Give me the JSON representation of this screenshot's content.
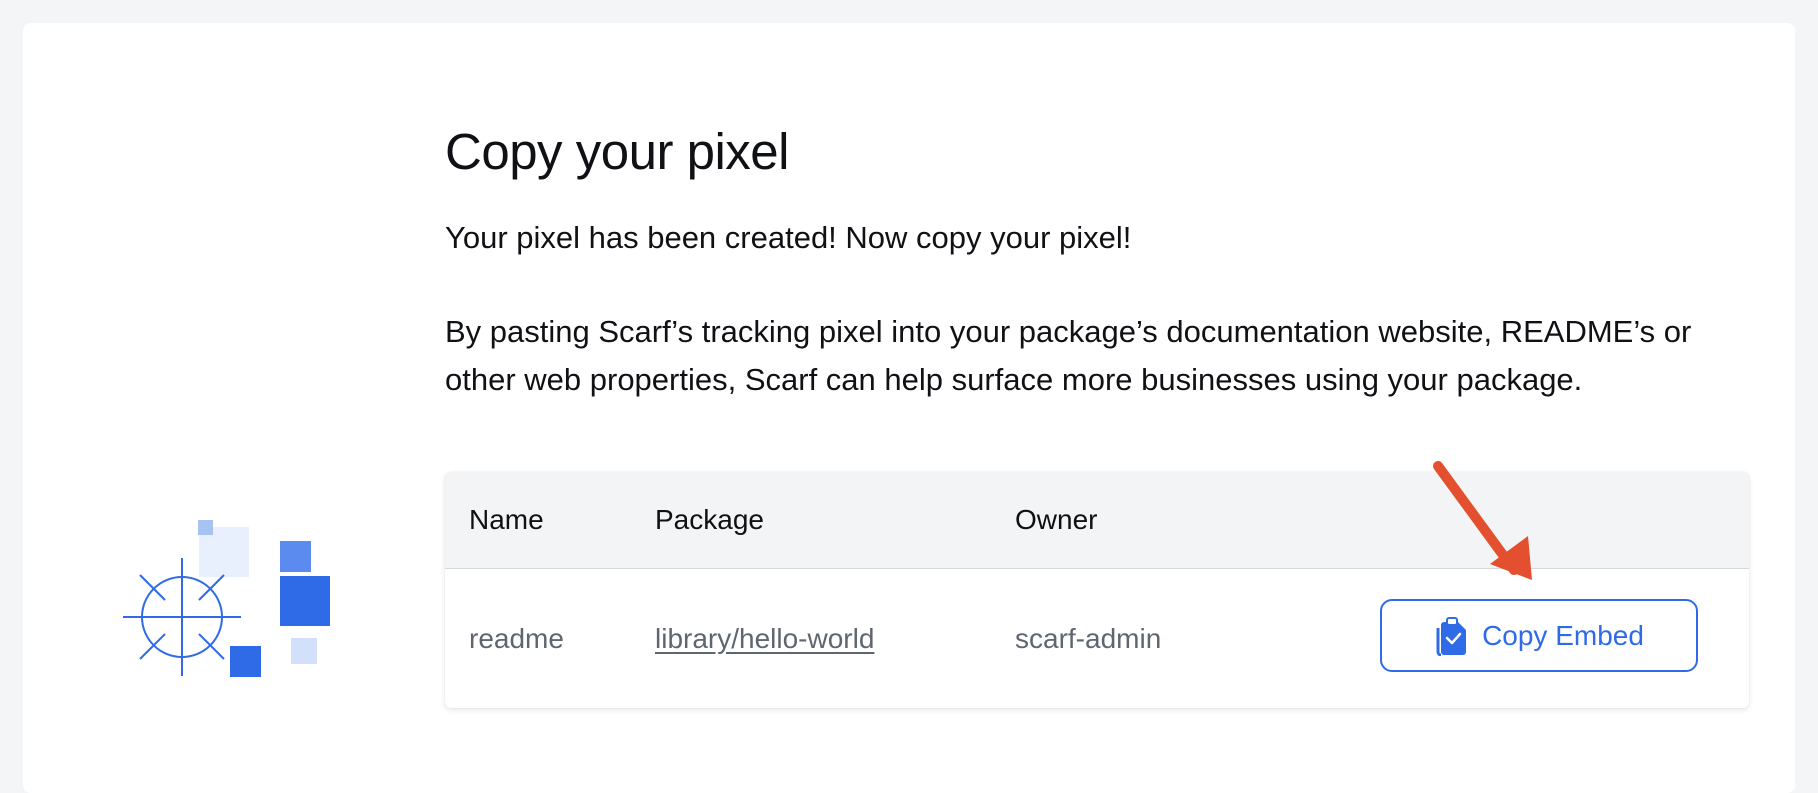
{
  "page": {
    "title": "Copy your pixel",
    "intro": "Your pixel has been created! Now copy your pixel!",
    "description": "By pasting Scarf’s tracking pixel into your package’s documentation website, README’s or other web properties, Scarf can help surface more businesses using your package."
  },
  "table": {
    "headers": {
      "name": "Name",
      "package": "Package",
      "owner": "Owner"
    },
    "rows": [
      {
        "name": "readme",
        "package": "library/hello-world",
        "owner": "scarf-admin",
        "action": "Copy Embed"
      }
    ]
  },
  "icons": {
    "copy": "clipboard-copy-icon",
    "illustration": "pixel-sun-illustration",
    "annotation": "red-arrow-annotation"
  },
  "colors": {
    "accent": "#2f6be6",
    "annotation": "#e4502f",
    "table_header_bg": "#f3f4f6",
    "muted_text": "#5f6670"
  }
}
